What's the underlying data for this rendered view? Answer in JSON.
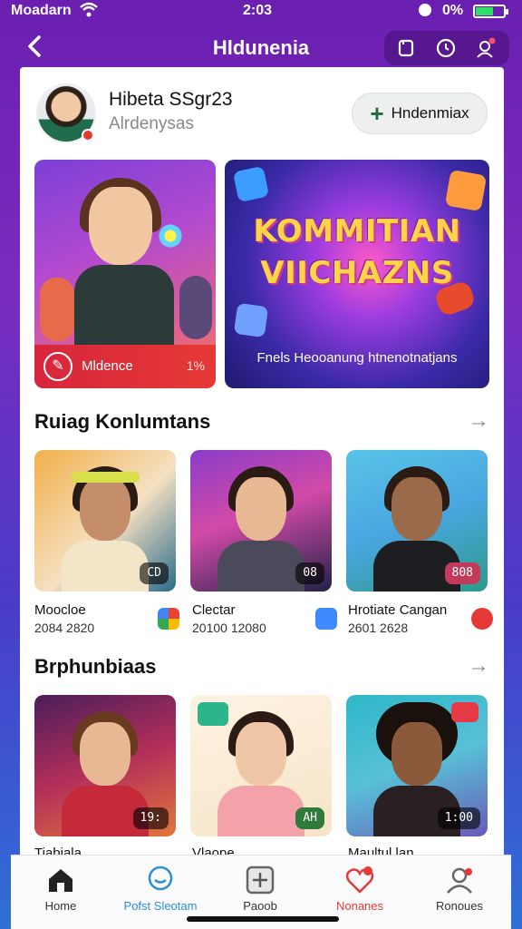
{
  "status": {
    "carrier": "Moadarn",
    "time": "2:03",
    "battery": "0%",
    "battery_level": 0.6
  },
  "header": {
    "back_icon": "chevron-left-icon",
    "title": "Hldunenia",
    "actions": [
      "square-icon",
      "clock-icon",
      "contact-icon"
    ]
  },
  "profile": {
    "name": "Hibeta SSgr23",
    "subtitle": "Alrdenysas",
    "follow_label": "Hndenmiax"
  },
  "banners": {
    "left_label": "Mldence",
    "left_pct": "1%",
    "right_title": "KOMMITIAN VIICHAZNS",
    "right_caption": "Fnels Heooanung htnenotnatjans"
  },
  "sections": [
    {
      "title": "Ruiag Konlumtans",
      "items": [
        {
          "name": "Moocloe",
          "stats": "2084 2820",
          "badge": "CD",
          "icon_color": "#4caf50"
        },
        {
          "name": "Clectar",
          "stats": "20100 12080",
          "badge": "08",
          "icon_color": "#3d8bff"
        },
        {
          "name": "Hrotiate Cangan",
          "stats": "2601 2628",
          "badge": "808",
          "icon_color": "#e53935"
        }
      ]
    },
    {
      "title": "Brphunbiaas",
      "items": [
        {
          "name": "Tiabiala",
          "badge": "19:",
          "icon_color": "#8a6bd6"
        },
        {
          "name": "Vlaope",
          "badge": "AH",
          "icon_color": "#ff9c3a"
        },
        {
          "name": "Maultul lan",
          "badge": "1:00",
          "icon_color": "#7a5cd6"
        }
      ]
    }
  ],
  "tabs": [
    {
      "label": "Home",
      "icon": "house-icon",
      "color": "#333333"
    },
    {
      "label": "Pofst Sleotam",
      "icon": "chat-bubble-icon",
      "color": "#2a8fd8"
    },
    {
      "label": "Paoob",
      "icon": "plus-square-icon",
      "color": "#555555"
    },
    {
      "label": "Nonanes",
      "icon": "heart-icon",
      "color": "#e53935"
    },
    {
      "label": "Ronoues",
      "icon": "person-icon",
      "color": "#666666"
    }
  ]
}
